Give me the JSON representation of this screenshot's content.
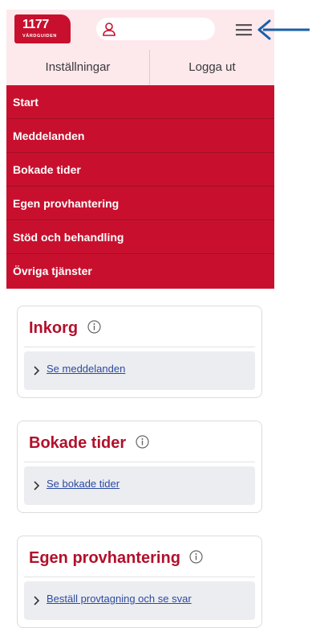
{
  "header": {
    "logo_number": "1177",
    "logo_subtitle": "VÅRDGUIDEN",
    "user_icon": "user-icon",
    "menu_icon": "hamburger-icon"
  },
  "annotation": {
    "arrow_icon": "arrow-left-icon",
    "color": "#1a5fa8"
  },
  "settings": {
    "settings_label": "Inställningar",
    "logout_label": "Logga ut"
  },
  "menu": {
    "items": [
      {
        "label": "Start"
      },
      {
        "label": "Meddelanden"
      },
      {
        "label": "Bokade tider"
      },
      {
        "label": "Egen provhantering"
      },
      {
        "label": "Stöd och behandling"
      },
      {
        "label": "Övriga tjänster"
      }
    ]
  },
  "cards": [
    {
      "title": "Inkorg",
      "link": "Se meddelanden"
    },
    {
      "title": "Bokade tider",
      "link": "Se bokade tider"
    },
    {
      "title": "Egen provhantering",
      "link": "Beställ provtagning och se svar"
    }
  ],
  "colors": {
    "brand": "#c8102e",
    "header_bg": "#fde8ec",
    "link": "#2b4aa0",
    "title": "#b2102c"
  }
}
